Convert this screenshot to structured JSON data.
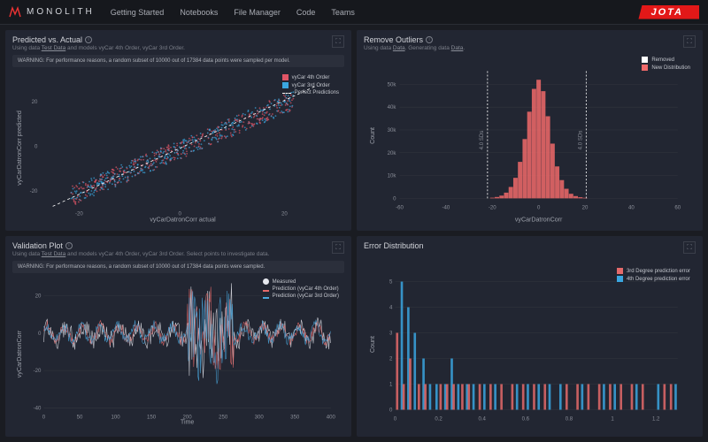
{
  "brand": {
    "name": "MONOLITH"
  },
  "nav": [
    "Getting Started",
    "Notebooks",
    "File Manager",
    "Code",
    "Teams"
  ],
  "partner_logo": "JOTA",
  "panels": {
    "pva": {
      "title": "Predicted vs. Actual",
      "sub_parts": [
        "Using data ",
        "Test Data",
        " and models vyCar 4th Order, vyCar 3rd Order."
      ],
      "warning": "WARNING: For performance reasons, a random subset of 10000 out of 17384 data points were sampled per model.",
      "xlabel": "vyCarDatronCorr actual",
      "ylabel": "vyCarDatronCorr predicted",
      "legend": [
        "vyCar 4th Order",
        "vyCar 3rd Order",
        "Perfect Predictions"
      ]
    },
    "outliers": {
      "title": "Remove Outliers",
      "sub_parts": [
        "Using data ",
        "Data",
        ". Generating data ",
        "Data",
        "."
      ],
      "xlabel": "vyCarDatronCorr",
      "ylabel": "Count",
      "legend": [
        "Removed",
        "New Distribution"
      ],
      "std_label": "4.0 SDs"
    },
    "validation": {
      "title": "Validation Plot",
      "sub_parts": [
        "Using data ",
        "Test Data",
        " and models vyCar 4th Order, vyCar 3rd Order. Select points to investigate data."
      ],
      "warning": "WARNING: For performance reasons, a random subset of 10000 out of 17384 data points were sampled.",
      "xlabel": "Time",
      "ylabel": "vyCarDatronCorr",
      "legend": [
        "Measured",
        "Prediction (vyCar 4th Order)",
        "Prediction (vyCar 3rd Order)"
      ]
    },
    "errdist": {
      "title": "Error Distribution",
      "xlabel": "",
      "ylabel": "Count",
      "legend": [
        "3rd Degree prediction error",
        "4th Degree prediction error"
      ]
    }
  },
  "chart_data": [
    {
      "id": "pva",
      "type": "scatter",
      "title": "Predicted vs. Actual",
      "xlabel": "vyCarDatronCorr actual",
      "ylabel": "vyCarDatronCorr predicted",
      "xlim": [
        -30,
        30
      ],
      "ylim": [
        -30,
        30
      ],
      "xticks": [
        -20,
        0,
        20
      ],
      "yticks": [
        -20,
        0,
        20
      ],
      "series": [
        {
          "name": "vyCar 4th Order",
          "color": "#e05566",
          "note": "~5000 points along y≈x with scatter ±5"
        },
        {
          "name": "vyCar 3rd Order",
          "color": "#3aa6e0",
          "note": "~5000 points along y≈x with scatter ±4"
        },
        {
          "name": "Perfect Predictions",
          "color": "#ffffff",
          "style": "dashed",
          "type": "line",
          "x": [
            -30,
            30
          ],
          "y": [
            -30,
            30
          ]
        }
      ]
    },
    {
      "id": "outliers",
      "type": "bar",
      "title": "Remove Outliers",
      "xlabel": "vyCarDatronCorr",
      "ylabel": "Count",
      "xlim": [
        -60,
        60
      ],
      "ylim": [
        0,
        55000
      ],
      "xticks": [
        -60,
        -40,
        -20,
        0,
        20,
        40,
        60
      ],
      "yticks_labels": [
        "0",
        "10k",
        "20k",
        "30k",
        "40k",
        "50k"
      ],
      "std_cutoffs": [
        -18,
        18
      ],
      "categories": [
        -20,
        -18,
        -16,
        -14,
        -12,
        -10,
        -8,
        -6,
        -4,
        -2,
        0,
        2,
        4,
        6,
        8,
        10,
        12,
        14,
        16,
        18,
        20
      ],
      "values": [
        300,
        600,
        1200,
        2500,
        5000,
        9000,
        16000,
        26000,
        38000,
        48000,
        52000,
        47000,
        36000,
        24000,
        14000,
        8000,
        4200,
        2000,
        1000,
        500,
        250
      ],
      "series_name": "New Distribution",
      "color": "#f06a6a",
      "removed_color": "#ffffff"
    },
    {
      "id": "validation",
      "type": "line",
      "title": "Validation Plot",
      "xlabel": "Time",
      "ylabel": "vyCarDatronCorr",
      "xlim": [
        0,
        400
      ],
      "ylim": [
        -40,
        20
      ],
      "xticks": [
        0,
        50,
        100,
        150,
        200,
        250,
        300,
        350,
        400
      ],
      "yticks": [
        -40,
        -20,
        0,
        20
      ],
      "series": [
        {
          "name": "Measured",
          "color": "#e6e8ee",
          "style": "points"
        },
        {
          "name": "Prediction (vyCar 4th Order)",
          "color": "#e46a6a"
        },
        {
          "name": "Prediction (vyCar 3rd Order)",
          "color": "#4aa8de"
        }
      ],
      "note": "Noisy time-series oscillating around 0, range mostly -15..15, occasional spikes to +20 / -40 near t≈210-260."
    },
    {
      "id": "errdist",
      "type": "bar",
      "title": "Error Distribution",
      "xlabel": "",
      "ylabel": "Count",
      "xlim": [
        0,
        1.3
      ],
      "ylim": [
        0,
        5
      ],
      "xticks": [
        0,
        0.2,
        0.4,
        0.6,
        0.8,
        1,
        1.2
      ],
      "yticks": [
        0,
        1,
        2,
        3,
        4,
        5
      ],
      "categories": [
        0.02,
        0.05,
        0.08,
        0.12,
        0.15,
        0.18,
        0.22,
        0.25,
        0.28,
        0.32,
        0.35,
        0.4,
        0.45,
        0.5,
        0.55,
        0.6,
        0.65,
        0.7,
        0.75,
        0.8,
        0.85,
        0.9,
        0.95,
        1.0,
        1.05,
        1.1,
        1.15,
        1.2,
        1.25,
        1.28
      ],
      "series": [
        {
          "name": "3rd Degree prediction error",
          "color": "#e46a6a",
          "values": [
            3,
            1,
            2,
            1,
            1,
            0,
            1,
            1,
            1,
            1,
            1,
            1,
            1,
            1,
            1,
            1,
            1,
            1,
            0,
            1,
            1,
            1,
            1,
            1,
            1,
            1,
            1,
            0,
            1,
            1
          ]
        },
        {
          "name": "4th Degree prediction error",
          "color": "#3aa6e0",
          "values": [
            5,
            4,
            3,
            2,
            1,
            1,
            1,
            2,
            1,
            1,
            1,
            1,
            1,
            0,
            1,
            1,
            1,
            1,
            1,
            0,
            1,
            0,
            1,
            1,
            0,
            1,
            0,
            1,
            0,
            1
          ]
        }
      ]
    }
  ]
}
